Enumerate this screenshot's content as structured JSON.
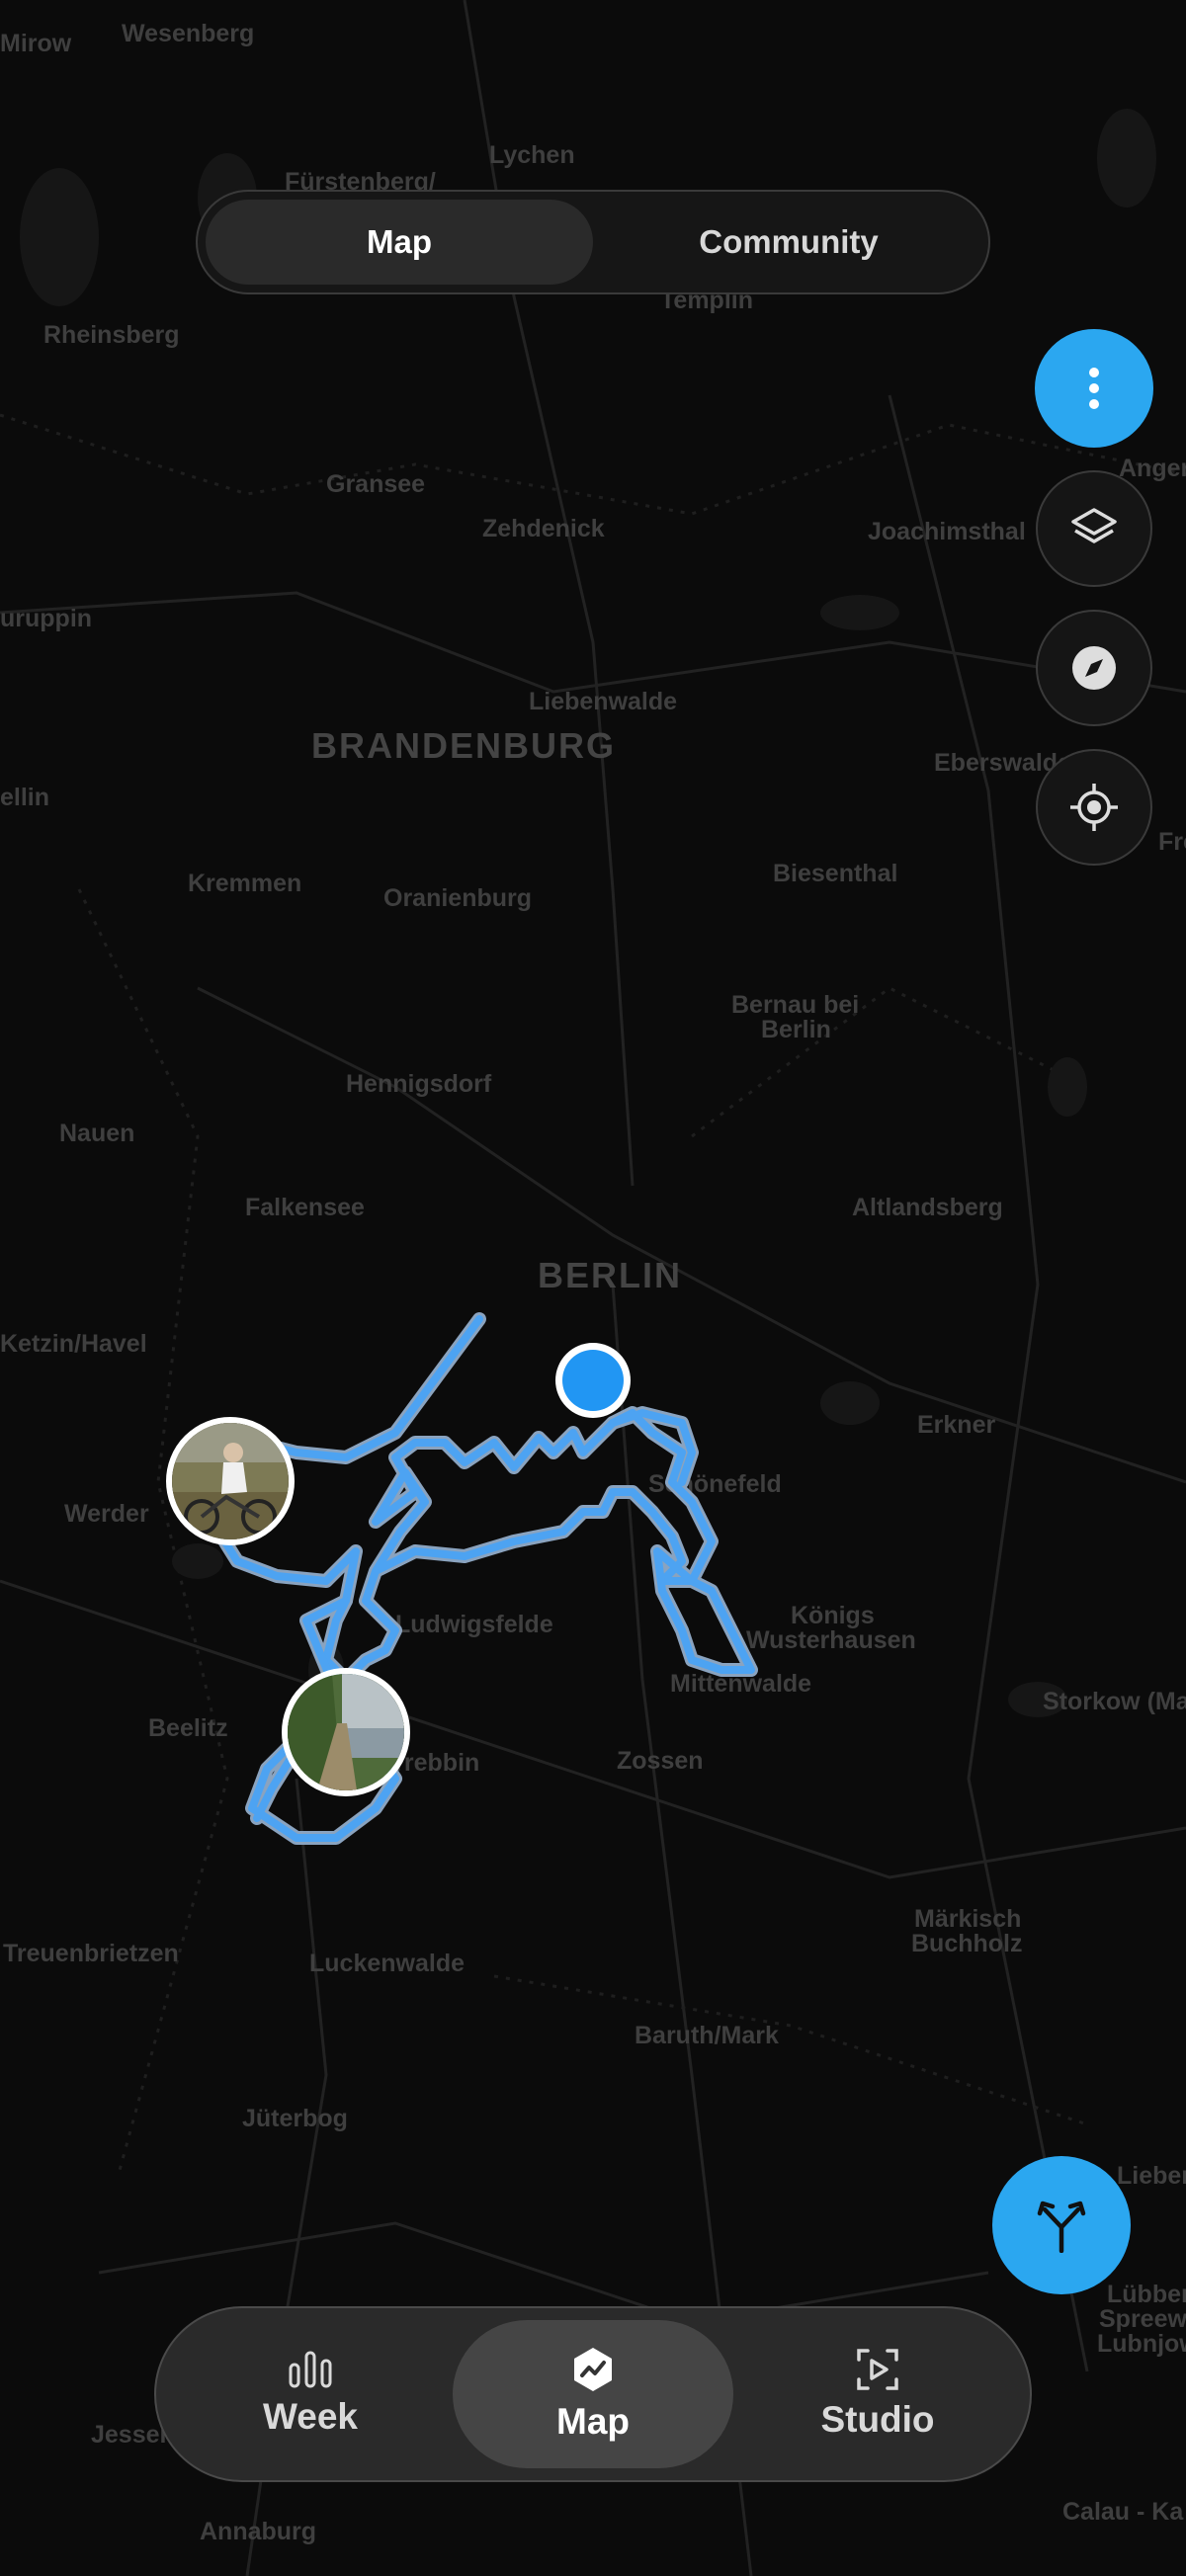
{
  "top_toggle": {
    "map_label": "Map",
    "community_label": "Community"
  },
  "map": {
    "region_labels": [
      "BRANDENBURG",
      "BERLIN"
    ],
    "towns": [
      "Mirow",
      "Wesenberg",
      "Fürstenberg/",
      "Lychen",
      "Templin",
      "Rheinsberg",
      "Gransee",
      "Zehdenick",
      "Joachimsthal",
      "uruppin",
      "Liebenwalde",
      "Angerm",
      "ellin",
      "Eberswalde",
      "Kremmen",
      "Oranienburg",
      "Biesenthal",
      "Fre",
      "Bernau bei",
      "Berlin",
      "Hennigsdorf",
      "Nauen",
      "Falkensee",
      "Altlandsberg",
      "Ketzin/Havel",
      "Erkner",
      "Werder",
      "Schönefeld",
      "Königs",
      "Wusterhausen",
      "Ludwigsfelde",
      "Mittenwalde",
      "Storkow (Ma",
      "Beelitz",
      "Trebbin",
      "Zossen",
      "Märkisch",
      "Buchholz",
      "Treuenbrietzen",
      "Luckenwalde",
      "Baruth/Mark",
      "Jüterbog",
      "Jessen",
      "Annaburg",
      "Lübben",
      "Spreewald",
      "Lubnjow",
      "Calau - Ka",
      "Lieberose"
    ],
    "photo_markers": [
      "cyclist-photo",
      "lakeside-path-photo"
    ]
  },
  "side_buttons": [
    "more-options",
    "layers",
    "compass",
    "recenter"
  ],
  "fab_route": "route-split",
  "bottom_nav": {
    "items": [
      {
        "label": "Week"
      },
      {
        "label": "Map"
      },
      {
        "label": "Studio"
      }
    ]
  },
  "colors": {
    "accent": "#2ba7f0",
    "route": "#5ea8ee",
    "map_bg": "#0b0b0b"
  }
}
